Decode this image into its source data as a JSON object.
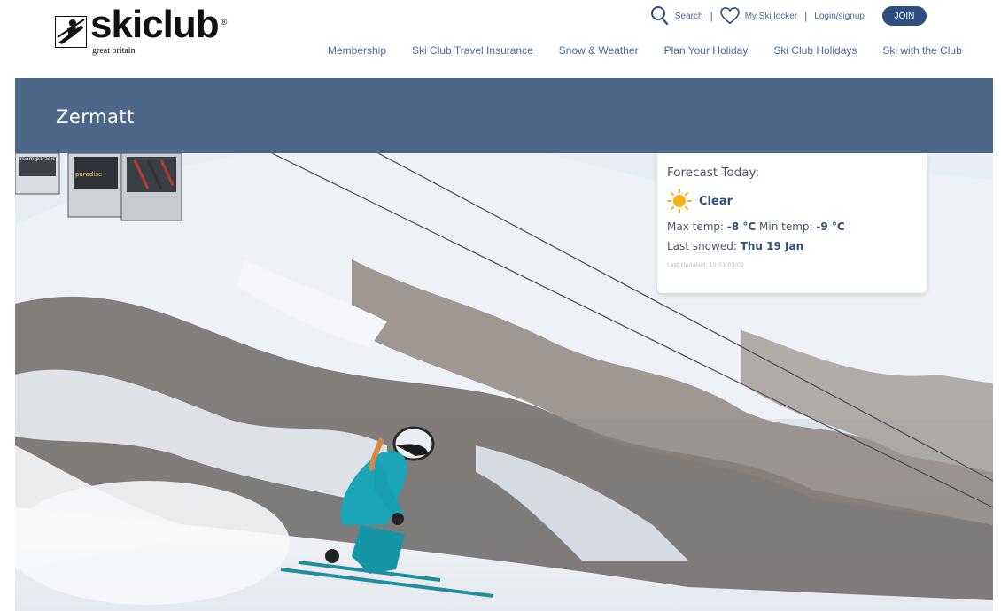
{
  "logo": {
    "name": "skiclub",
    "registered": "®",
    "tagline": "great britain"
  },
  "utility": {
    "search_label": "Search",
    "separator": "|",
    "locker_label": "My Ski locker",
    "login_label": "Login/signup",
    "join_label": "JOIN"
  },
  "nav": {
    "items": [
      {
        "label": "Membership"
      },
      {
        "label": "Ski Club Travel Insurance"
      },
      {
        "label": "Snow & Weather"
      },
      {
        "label": "Plan Your Holiday"
      },
      {
        "label": "Ski Club Holidays"
      },
      {
        "label": "Ski with the Club"
      }
    ]
  },
  "page": {
    "title": "Zermatt"
  },
  "forecast": {
    "heading": "Forecast Today:",
    "condition": "Clear",
    "max_label": "Max temp:",
    "max_value": "-8 °C",
    "min_label": "Min temp:",
    "min_value": "-9 °C",
    "snowed_label": "Last snowed:",
    "snowed_value": "Thu 19 Jan",
    "updated": "Last Updated: 15:51 03/02"
  },
  "hero_gondola_text": [
    "dream paradise",
    "paradise"
  ],
  "colors": {
    "brand_blue": "#2e4e7e",
    "nav_text": "#4a6a9a",
    "title_band": "#4e6788",
    "sun": "#f6b21b"
  },
  "icons": [
    "search-icon",
    "heart-icon",
    "sun-icon",
    "skiclub-logo-icon"
  ]
}
